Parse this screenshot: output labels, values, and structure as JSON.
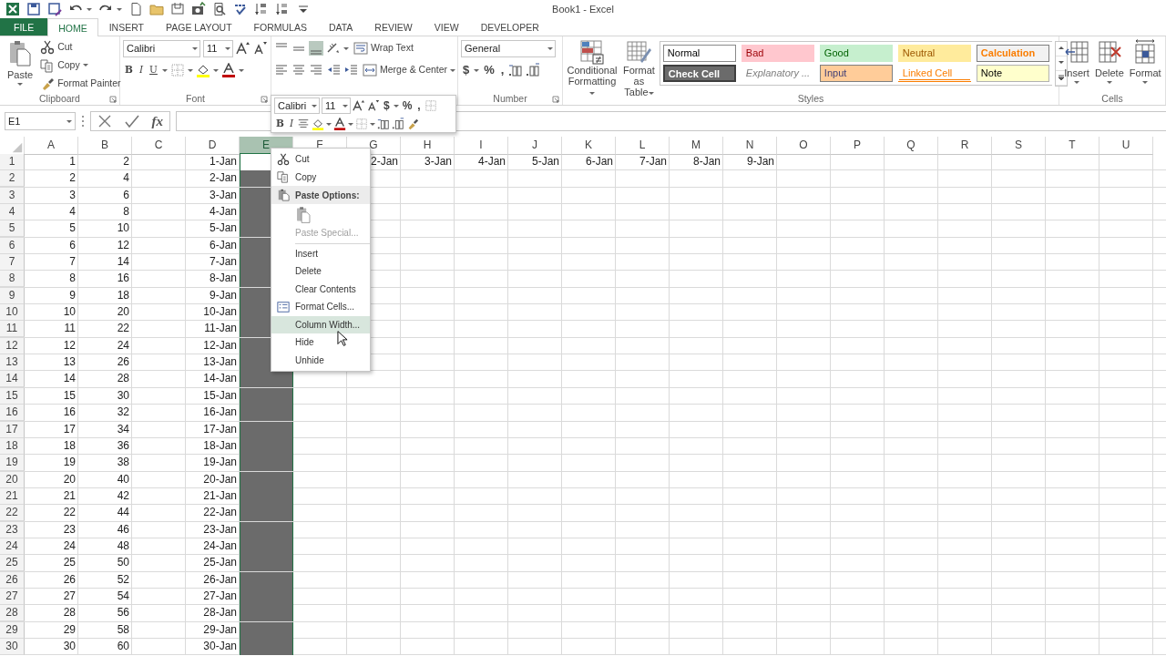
{
  "window": {
    "title": "Book1 - Excel"
  },
  "tabs": [
    {
      "label": "FILE",
      "kind": "file",
      "selected": false
    },
    {
      "label": "HOME",
      "kind": "tab",
      "selected": true
    },
    {
      "label": "INSERT",
      "kind": "tab",
      "selected": false
    },
    {
      "label": "PAGE LAYOUT",
      "kind": "tab",
      "selected": false
    },
    {
      "label": "FORMULAS",
      "kind": "tab",
      "selected": false
    },
    {
      "label": "DATA",
      "kind": "tab",
      "selected": false
    },
    {
      "label": "REVIEW",
      "kind": "tab",
      "selected": false
    },
    {
      "label": "VIEW",
      "kind": "tab",
      "selected": false
    },
    {
      "label": "DEVELOPER",
      "kind": "tab",
      "selected": false
    }
  ],
  "ribbon": {
    "clipboard": {
      "label": "Clipboard",
      "paste": "Paste",
      "commands": [
        "Cut",
        "Copy",
        "Format Painter"
      ]
    },
    "font": {
      "label": "Font",
      "font_name": "Calibri",
      "font_size": "11",
      "styles": [
        "B",
        "I",
        "U"
      ]
    },
    "alignment": {
      "commands": [
        "Wrap Text",
        "Merge & Center"
      ]
    },
    "number": {
      "label": "Number",
      "format": "General",
      "symbols": [
        "$",
        "%",
        ","
      ]
    },
    "styles": {
      "label": "Styles",
      "commands": [
        "Conditional Formatting",
        "Format as Table"
      ],
      "cell_styles": [
        {
          "name": "Normal",
          "kind": "normal",
          "color": "#ffffff"
        },
        {
          "name": "Bad",
          "kind": "bad",
          "color": "#ffc7ce"
        },
        {
          "name": "Good",
          "kind": "good",
          "color": "#c6efce"
        },
        {
          "name": "Neutral",
          "kind": "neutral",
          "color": "#ffeb9c"
        },
        {
          "name": "Calculation",
          "kind": "calculation",
          "color": "#f2f2f2"
        },
        {
          "name": "Check Cell",
          "kind": "check",
          "color": "#6b6b6b"
        },
        {
          "name": "Explanatory ...",
          "kind": "explanatory",
          "color": "#ffffff"
        },
        {
          "name": "Input",
          "kind": "input",
          "color": "#ffcc99"
        },
        {
          "name": "Linked Cell",
          "kind": "linked",
          "color": "#ffffff"
        },
        {
          "name": "Note",
          "kind": "note",
          "color": "#ffffcc"
        }
      ]
    },
    "cells": {
      "label": "Cells",
      "commands": [
        "Insert",
        "Delete",
        "Format"
      ]
    }
  },
  "formula_bar": {
    "name_box": "E1",
    "function_label": "fx"
  },
  "mini_toolbar": {
    "font_name": "Calibri",
    "font_size": "11",
    "symbols": [
      "$",
      "%",
      ","
    ],
    "styles": [
      "B",
      "I"
    ]
  },
  "sheet": {
    "columns": [
      {
        "label": "A",
        "selected": false
      },
      {
        "label": "B",
        "selected": false
      },
      {
        "label": "C",
        "selected": false
      },
      {
        "label": "D",
        "selected": false
      },
      {
        "label": "E",
        "selected": true
      },
      {
        "label": "F",
        "selected": false
      },
      {
        "label": "G",
        "selected": false
      },
      {
        "label": "H",
        "selected": false
      },
      {
        "label": "I",
        "selected": false
      },
      {
        "label": "J",
        "selected": false
      },
      {
        "label": "K",
        "selected": false
      },
      {
        "label": "L",
        "selected": false
      },
      {
        "label": "M",
        "selected": false
      },
      {
        "label": "N",
        "selected": false
      },
      {
        "label": "O",
        "selected": false
      },
      {
        "label": "P",
        "selected": false
      },
      {
        "label": "Q",
        "selected": false
      },
      {
        "label": "R",
        "selected": false
      },
      {
        "label": "S",
        "selected": false
      },
      {
        "label": "T",
        "selected": false
      },
      {
        "label": "U",
        "selected": false
      }
    ],
    "rows": [
      {
        "number": "1",
        "active_cell": true,
        "cells": [
          "1",
          "2",
          null,
          "1-Jan",
          null,
          null,
          "2-Jan",
          "3-Jan",
          "4-Jan",
          "5-Jan",
          "6-Jan",
          "7-Jan",
          "8-Jan",
          "9-Jan"
        ]
      },
      {
        "number": "2",
        "active_cell": false,
        "cells": [
          "2",
          "4",
          null,
          "2-Jan"
        ]
      },
      {
        "number": "3",
        "active_cell": false,
        "cells": [
          "3",
          "6",
          null,
          "3-Jan"
        ]
      },
      {
        "number": "4",
        "active_cell": false,
        "cells": [
          "4",
          "8",
          null,
          "4-Jan"
        ]
      },
      {
        "number": "5",
        "active_cell": false,
        "cells": [
          "5",
          "10",
          null,
          "5-Jan"
        ]
      },
      {
        "number": "6",
        "active_cell": false,
        "cells": [
          "6",
          "12",
          null,
          "6-Jan"
        ]
      },
      {
        "number": "7",
        "active_cell": false,
        "cells": [
          "7",
          "14",
          null,
          "7-Jan"
        ]
      },
      {
        "number": "8",
        "active_cell": false,
        "cells": [
          "8",
          "16",
          null,
          "8-Jan"
        ]
      },
      {
        "number": "9",
        "active_cell": false,
        "cells": [
          "9",
          "18",
          null,
          "9-Jan"
        ]
      },
      {
        "number": "10",
        "active_cell": false,
        "cells": [
          "10",
          "20",
          null,
          "10-Jan"
        ]
      },
      {
        "number": "11",
        "active_cell": false,
        "cells": [
          "11",
          "22",
          null,
          "11-Jan"
        ]
      },
      {
        "number": "12",
        "active_cell": false,
        "cells": [
          "12",
          "24",
          null,
          "12-Jan"
        ]
      },
      {
        "number": "13",
        "active_cell": false,
        "cells": [
          "13",
          "26",
          null,
          "13-Jan"
        ]
      },
      {
        "number": "14",
        "active_cell": false,
        "cells": [
          "14",
          "28",
          null,
          "14-Jan"
        ]
      },
      {
        "number": "15",
        "active_cell": false,
        "cells": [
          "15",
          "30",
          null,
          "15-Jan"
        ]
      },
      {
        "number": "16",
        "active_cell": false,
        "cells": [
          "16",
          "32",
          null,
          "16-Jan"
        ]
      },
      {
        "number": "17",
        "active_cell": false,
        "cells": [
          "17",
          "34",
          null,
          "17-Jan"
        ]
      },
      {
        "number": "18",
        "active_cell": false,
        "cells": [
          "18",
          "36",
          null,
          "18-Jan"
        ]
      },
      {
        "number": "19",
        "active_cell": false,
        "cells": [
          "19",
          "38",
          null,
          "19-Jan"
        ]
      },
      {
        "number": "20",
        "active_cell": false,
        "cells": [
          "20",
          "40",
          null,
          "20-Jan"
        ]
      },
      {
        "number": "21",
        "active_cell": false,
        "cells": [
          "21",
          "42",
          null,
          "21-Jan"
        ]
      },
      {
        "number": "22",
        "active_cell": false,
        "cells": [
          "22",
          "44",
          null,
          "22-Jan"
        ]
      },
      {
        "number": "23",
        "active_cell": false,
        "cells": [
          "23",
          "46",
          null,
          "23-Jan"
        ]
      },
      {
        "number": "24",
        "active_cell": false,
        "cells": [
          "24",
          "48",
          null,
          "24-Jan"
        ]
      },
      {
        "number": "25",
        "active_cell": false,
        "cells": [
          "25",
          "50",
          null,
          "25-Jan"
        ]
      },
      {
        "number": "26",
        "active_cell": false,
        "cells": [
          "26",
          "52",
          null,
          "26-Jan"
        ]
      },
      {
        "number": "27",
        "active_cell": false,
        "cells": [
          "27",
          "54",
          null,
          "27-Jan"
        ]
      },
      {
        "number": "28",
        "active_cell": false,
        "cells": [
          "28",
          "56",
          null,
          "28-Jan"
        ]
      },
      {
        "number": "29",
        "active_cell": false,
        "cells": [
          "29",
          "58",
          null,
          "29-Jan"
        ]
      },
      {
        "number": "30",
        "active_cell": false,
        "cells": [
          "30",
          "60",
          null,
          "30-Jan"
        ]
      }
    ]
  },
  "context_menu": {
    "items": [
      {
        "label": "Cut",
        "kind": "command",
        "selected": false,
        "disabled": false,
        "separator_before": false
      },
      {
        "label": "Copy",
        "kind": "command",
        "selected": false,
        "disabled": false,
        "separator_before": false
      },
      {
        "label": "Paste Options:",
        "kind": "header"
      },
      {
        "kind": "paste_options"
      },
      {
        "label": "Paste Special...",
        "kind": "command",
        "selected": false,
        "disabled": true,
        "separator_before": false
      },
      {
        "label": "Insert",
        "kind": "command",
        "selected": false,
        "disabled": false,
        "separator_before": true
      },
      {
        "label": "Delete",
        "kind": "command",
        "selected": false,
        "disabled": false,
        "separator_before": false
      },
      {
        "label": "Clear Contents",
        "kind": "command",
        "selected": false,
        "disabled": false,
        "separator_before": false
      },
      {
        "label": "Format Cells...",
        "kind": "command",
        "selected": false,
        "disabled": false,
        "separator_before": false
      },
      {
        "label": "Column Width...",
        "kind": "command",
        "selected": true,
        "disabled": false,
        "separator_before": false
      },
      {
        "label": "Hide",
        "kind": "command",
        "selected": false,
        "disabled": false,
        "separator_before": false
      },
      {
        "label": "Unhide",
        "kind": "command",
        "selected": false,
        "disabled": false,
        "separator_before": false
      }
    ]
  }
}
